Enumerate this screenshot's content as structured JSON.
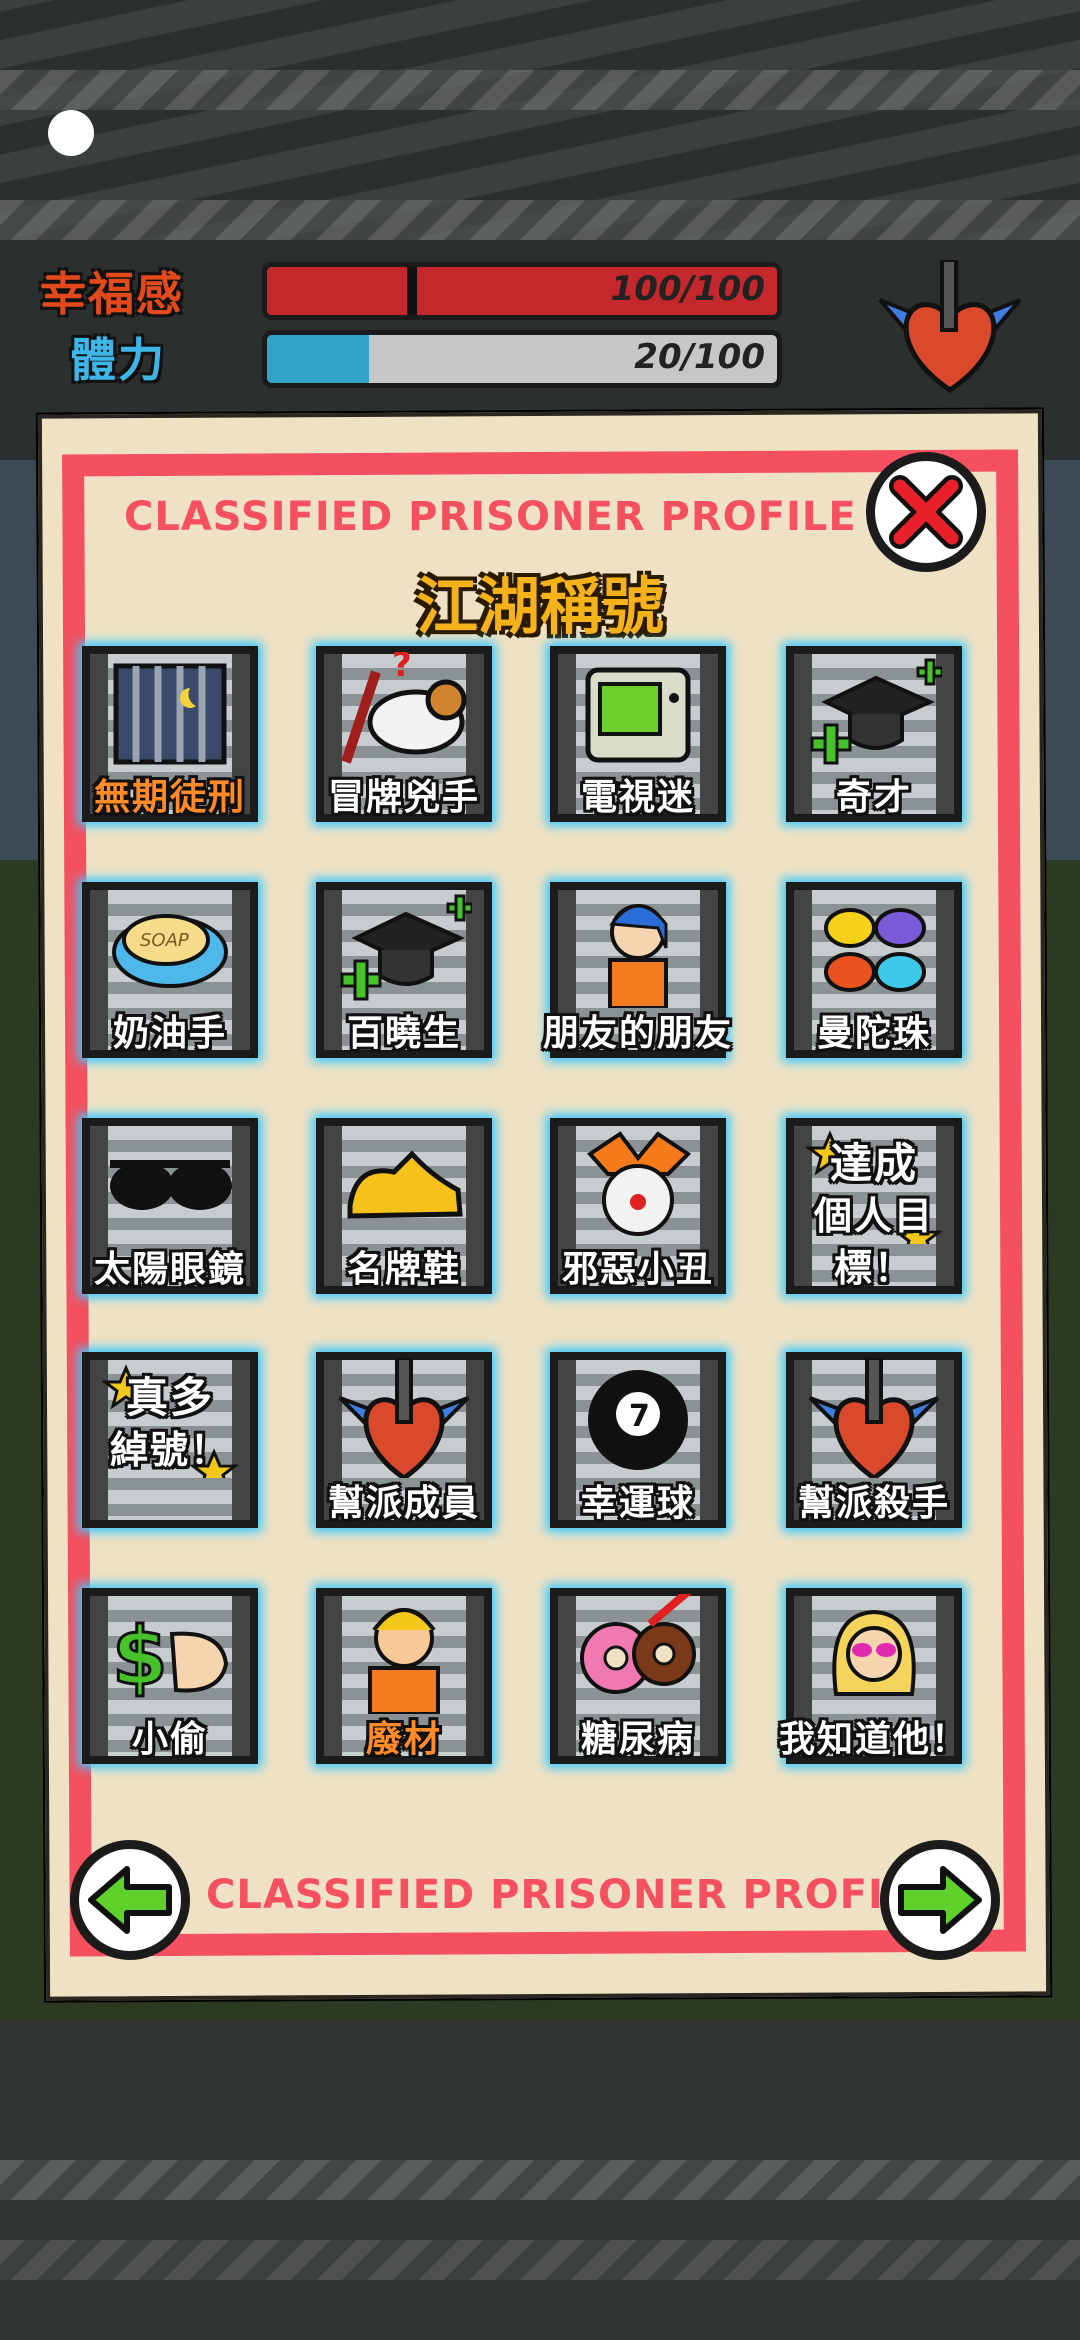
{
  "stats": [
    {
      "label": "幸福感",
      "value": "100/100",
      "fill": 1.0,
      "color": "#c5282c",
      "label_color": "#e2491d"
    },
    {
      "label": "體力",
      "value": "20/100",
      "fill": 0.2,
      "color": "#2fa3c8",
      "label_color": "#3fb6e8"
    }
  ],
  "profile": {
    "header": "CLASSIFIED PRISONER PROFILE",
    "footer": "CLASSIFIED PRISONER PROFILE",
    "title": "江湖稱號"
  },
  "tiles": [
    {
      "label": "無期徒刑",
      "icon": "prison-bars-icon",
      "orange": true
    },
    {
      "label": "冒牌兇手",
      "icon": "goat-icon"
    },
    {
      "label": "電視迷",
      "icon": "tv-icon"
    },
    {
      "label": "奇才",
      "icon": "graduation-cap-icon"
    },
    {
      "label": "奶油手",
      "icon": "soap-icon"
    },
    {
      "label": "百曉生",
      "icon": "graduation-cap-icon"
    },
    {
      "label": "朋友的朋友",
      "icon": "friend-icon"
    },
    {
      "label": "曼陀珠",
      "icon": "candy-icon"
    },
    {
      "label": "太陽眼鏡",
      "icon": "sunglasses-icon"
    },
    {
      "label": "名牌鞋",
      "icon": "shoe-icon"
    },
    {
      "label": "邪惡小丑",
      "icon": "clown-icon"
    },
    {
      "label": "達成個人目標！",
      "icon": "stars-icon",
      "line1": "達成",
      "line2": "個人目標！"
    },
    {
      "label": "真多綽號！",
      "icon": "stars-icon",
      "line1": "真多",
      "line2": "綽號！"
    },
    {
      "label": "幫派成員",
      "icon": "gang-heart-icon"
    },
    {
      "label": "幸運球",
      "icon": "eight-ball-icon"
    },
    {
      "label": "幫派殺手",
      "icon": "gang-heart-icon"
    },
    {
      "label": "小偷",
      "icon": "hand-money-icon"
    },
    {
      "label": "廢材",
      "icon": "prisoner-icon",
      "orange": true
    },
    {
      "label": "糖尿病",
      "icon": "donut-icon"
    },
    {
      "label": "我知道他！",
      "icon": "blonde-woman-icon"
    }
  ]
}
